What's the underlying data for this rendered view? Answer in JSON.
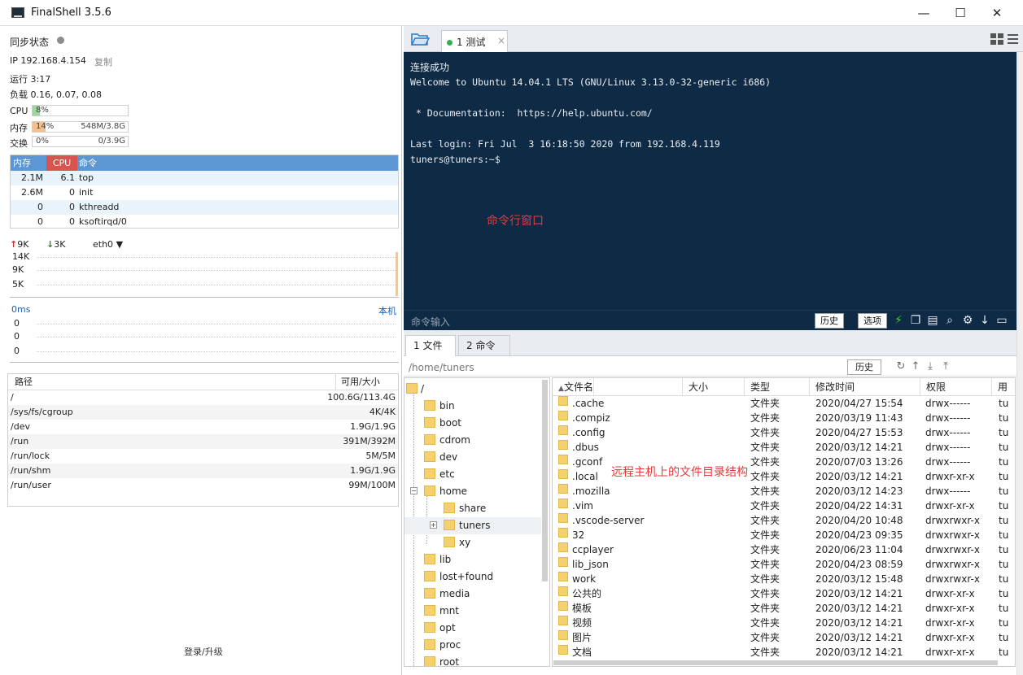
{
  "window": {
    "title": "FinalShell 3.5.6",
    "minimize": "—",
    "maximize": "☐",
    "close": "✕"
  },
  "status": {
    "sync_label": "同步状态",
    "ip": "IP 192.168.4.154",
    "copy": "复制",
    "uptime": "运行 3:17",
    "load": "负载 0.16, 0.07, 0.08",
    "cpu": {
      "label": "CPU",
      "percent": "8%",
      "fill": 8
    },
    "mem": {
      "label": "内存",
      "percent": "14%",
      "amount": "548M/3.8G",
      "fill": 14
    },
    "swap": {
      "label": "交换",
      "percent": "0%",
      "amount": "0/3.9G",
      "fill": 0
    }
  },
  "processes": {
    "headers": {
      "mem": "内存",
      "cpu": "CPU",
      "cmd": "命令"
    },
    "rows": [
      {
        "mem": "2.1M",
        "cpu": "6.1",
        "cmd": "top"
      },
      {
        "mem": "2.6M",
        "cpu": "0",
        "cmd": "init"
      },
      {
        "mem": "0",
        "cpu": "0",
        "cmd": "kthreadd"
      },
      {
        "mem": "0",
        "cpu": "0",
        "cmd": "ksoftirqd/0"
      }
    ]
  },
  "network": {
    "up": "9K",
    "down": "3K",
    "interface": "eth0",
    "yticks": [
      "14K",
      "9K",
      "5K"
    ]
  },
  "latency": {
    "label": "0ms",
    "host": "本机",
    "yticks": [
      "0",
      "0",
      "0"
    ]
  },
  "disks": {
    "headers": {
      "path": "路径",
      "size": "可用/大小"
    },
    "rows": [
      {
        "path": "/",
        "size": "100.6G/113.4G"
      },
      {
        "path": "/sys/fs/cgroup",
        "size": "4K/4K"
      },
      {
        "path": "/dev",
        "size": "1.9G/1.9G"
      },
      {
        "path": "/run",
        "size": "391M/392M"
      },
      {
        "path": "/run/lock",
        "size": "5M/5M"
      },
      {
        "path": "/run/shm",
        "size": "1.9G/1.9G"
      },
      {
        "path": "/run/user",
        "size": "99M/100M"
      }
    ]
  },
  "login_label": "登录/升级",
  "session_tab": {
    "label": "1 测试",
    "close": "×"
  },
  "terminal": {
    "lines": [
      "连接成功",
      "Welcome to Ubuntu 14.04.1 LTS (GNU/Linux 3.13.0-32-generic i686)",
      "",
      " * Documentation:  https://help.ubuntu.com/",
      "",
      "Last login: Fri Jul  3 16:18:50 2020 from 192.168.4.119",
      "tuners@tuners:~$"
    ],
    "annotation": "命令行窗口",
    "input_label": "命令输入",
    "history_button": "历史",
    "options_button": "选项"
  },
  "file_tabs": [
    "1 文件",
    "2 命令"
  ],
  "path": {
    "current": "/home/tuners",
    "history_button": "历史"
  },
  "tree": [
    {
      "label": "/",
      "level": 0
    },
    {
      "label": "bin",
      "level": 1
    },
    {
      "label": "boot",
      "level": 1
    },
    {
      "label": "cdrom",
      "level": 1
    },
    {
      "label": "dev",
      "level": 1
    },
    {
      "label": "etc",
      "level": 1
    },
    {
      "label": "home",
      "level": 1,
      "expanded": true
    },
    {
      "label": "share",
      "level": 2
    },
    {
      "label": "tuners",
      "level": 2,
      "selected": true,
      "collapsed": true
    },
    {
      "label": "xy",
      "level": 2
    },
    {
      "label": "lib",
      "level": 1
    },
    {
      "label": "lost+found",
      "level": 1
    },
    {
      "label": "media",
      "level": 1
    },
    {
      "label": "mnt",
      "level": 1
    },
    {
      "label": "opt",
      "level": 1
    },
    {
      "label": "proc",
      "level": 1
    },
    {
      "label": "root",
      "level": 1
    }
  ],
  "file_list": {
    "headers": {
      "name": "文件名",
      "size": "大小",
      "type": "类型",
      "modified": "修改时间",
      "perm": "权限",
      "user": "用"
    },
    "annotation": "远程主机上的文件目录结构",
    "rows": [
      {
        "name": ".cache",
        "type": "文件夹",
        "modified": "2020/04/27 15:54",
        "perm": "drwx------",
        "user": "tu"
      },
      {
        "name": ".compiz",
        "type": "文件夹",
        "modified": "2020/03/19 11:43",
        "perm": "drwx------",
        "user": "tu"
      },
      {
        "name": ".config",
        "type": "文件夹",
        "modified": "2020/04/27 15:53",
        "perm": "drwx------",
        "user": "tu"
      },
      {
        "name": ".dbus",
        "type": "文件夹",
        "modified": "2020/03/12 14:21",
        "perm": "drwx------",
        "user": "tu"
      },
      {
        "name": ".gconf",
        "type": "文件夹",
        "modified": "2020/07/03 13:26",
        "perm": "drwx------",
        "user": "tu"
      },
      {
        "name": ".local",
        "type": "文件夹",
        "modified": "2020/03/12 14:21",
        "perm": "drwxr-xr-x",
        "user": "tu"
      },
      {
        "name": ".mozilla",
        "type": "文件夹",
        "modified": "2020/03/12 14:23",
        "perm": "drwx------",
        "user": "tu"
      },
      {
        "name": ".vim",
        "type": "文件夹",
        "modified": "2020/04/22 14:31",
        "perm": "drwxr-xr-x",
        "user": "tu"
      },
      {
        "name": ".vscode-server",
        "type": "文件夹",
        "modified": "2020/04/20 10:48",
        "perm": "drwxrwxr-x",
        "user": "tu"
      },
      {
        "name": "32",
        "type": "文件夹",
        "modified": "2020/04/23 09:35",
        "perm": "drwxrwxr-x",
        "user": "tu"
      },
      {
        "name": "ccplayer",
        "type": "文件夹",
        "modified": "2020/06/23 11:04",
        "perm": "drwxrwxr-x",
        "user": "tu"
      },
      {
        "name": "lib_json",
        "type": "文件夹",
        "modified": "2020/04/23 08:59",
        "perm": "drwxrwxr-x",
        "user": "tu"
      },
      {
        "name": "work",
        "type": "文件夹",
        "modified": "2020/03/12 15:48",
        "perm": "drwxrwxr-x",
        "user": "tu"
      },
      {
        "name": "公共的",
        "type": "文件夹",
        "modified": "2020/03/12 14:21",
        "perm": "drwxr-xr-x",
        "user": "tu"
      },
      {
        "name": "模板",
        "type": "文件夹",
        "modified": "2020/03/12 14:21",
        "perm": "drwxr-xr-x",
        "user": "tu"
      },
      {
        "name": "视频",
        "type": "文件夹",
        "modified": "2020/03/12 14:21",
        "perm": "drwxr-xr-x",
        "user": "tu"
      },
      {
        "name": "图片",
        "type": "文件夹",
        "modified": "2020/03/12 14:21",
        "perm": "drwxr-xr-x",
        "user": "tu"
      },
      {
        "name": "文档",
        "type": "文件夹",
        "modified": "2020/03/12 14:21",
        "perm": "drwxr-xr-x",
        "user": "tu"
      }
    ]
  },
  "colors": {
    "accent_blue": "#5c97d3",
    "cpu_red": "#d9534f",
    "terminal_bg": "#0f2a44",
    "annotation_red": "#e33b3b",
    "cpu_fill": "#9fd39f",
    "mem_fill": "#f4c08d"
  }
}
